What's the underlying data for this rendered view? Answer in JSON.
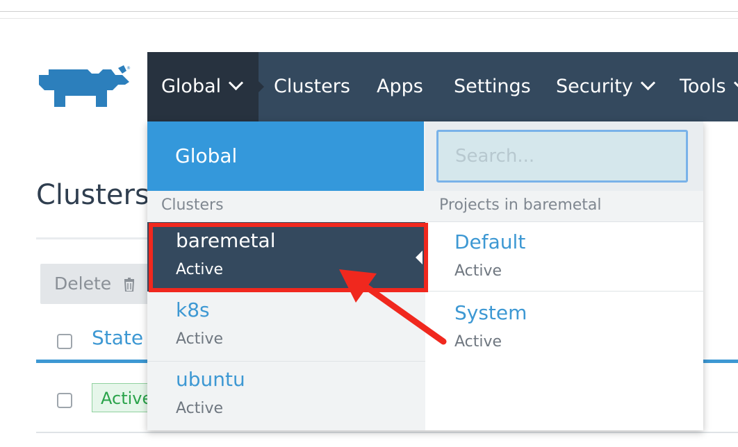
{
  "nav": {
    "items": [
      {
        "label": "Global",
        "has_chevron": true,
        "active": true
      },
      {
        "label": "Clusters",
        "has_chevron": false
      },
      {
        "label": "Apps",
        "has_chevron": false
      },
      {
        "label": "Settings",
        "has_chevron": false
      },
      {
        "label": "Security",
        "has_chevron": true
      },
      {
        "label": "Tools",
        "has_chevron": true
      }
    ]
  },
  "page": {
    "title": "Clusters",
    "delete_label": "Delete",
    "state_header": "State",
    "row_state": "Active"
  },
  "dropdown": {
    "global_label": "Global",
    "clusters_section_label": "Clusters",
    "clusters": [
      {
        "name": "baremetal",
        "status": "Active",
        "selected": true
      },
      {
        "name": "k8s",
        "status": "Active"
      },
      {
        "name": "ubuntu",
        "status": "Active"
      }
    ],
    "search_placeholder": "Search...",
    "projects_section_label": "Projects in baremetal",
    "projects": [
      {
        "name": "Default",
        "status": "Active"
      },
      {
        "name": "System",
        "status": "Active"
      }
    ]
  },
  "colors": {
    "nav_bg": "#34495e",
    "nav_active_bg": "#27323f",
    "accent_blue": "#3498db",
    "annotation_red": "#f0281e"
  },
  "icons": {
    "logo": "rancher-logo",
    "trash": "trash-icon"
  }
}
